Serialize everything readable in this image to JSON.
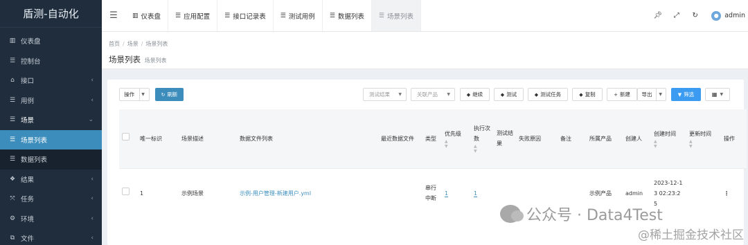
{
  "app": {
    "title": "盾测-自动化"
  },
  "sidebar": {
    "items": [
      {
        "icon": "bar-chart-icon",
        "label": "仪表盘"
      },
      {
        "icon": "list-icon",
        "label": "控制台"
      },
      {
        "icon": "bank-icon",
        "label": "接口"
      },
      {
        "icon": "list-icon",
        "label": "用例"
      },
      {
        "icon": "list-icon",
        "label": "场景"
      },
      {
        "icon": "list-icon",
        "label": "场景列表"
      },
      {
        "icon": "list-icon",
        "label": "数据列表"
      },
      {
        "icon": "cubes-icon",
        "label": "结果"
      },
      {
        "icon": "expand-icon",
        "label": "任务"
      },
      {
        "icon": "gear-icon",
        "label": "环境"
      },
      {
        "icon": "copy-icon",
        "label": "文件"
      }
    ]
  },
  "topbar": {
    "tabs": [
      {
        "icon": "bar-chart-icon",
        "label": "仪表盘"
      },
      {
        "icon": "list-icon",
        "label": "应用配置"
      },
      {
        "icon": "list-icon",
        "label": "接口记录表"
      },
      {
        "icon": "list-icon",
        "label": "测试用例"
      },
      {
        "icon": "list-icon",
        "label": "数据列表"
      },
      {
        "icon": "list-icon",
        "label": "场景列表"
      }
    ],
    "user": "admin"
  },
  "breadcrumb": [
    "首页",
    "场景",
    "场景列表"
  ],
  "page": {
    "title": "场景列表",
    "subtitle": "场景列表"
  },
  "toolbar": {
    "actions_label": "操作",
    "refresh_label": "刷新",
    "result_placeholder": "测试结果",
    "product_placeholder": "关联产品",
    "continue_label": "继续",
    "test_label": "测试",
    "test_task_label": "测试任务",
    "copy_label": "复制",
    "new_label": "新建",
    "export_label": "导出",
    "filter_label": "筛选"
  },
  "table": {
    "headers": {
      "id": "唯一标识",
      "desc": "场景描述",
      "files": "数据文件列表",
      "recent": "最近数据文件",
      "type": "类型",
      "priority": "优先级",
      "runs": "执行次数",
      "result": "测试结果",
      "fail": "失败原因",
      "remark": "备注",
      "product": "所属产品",
      "creator": "创建人",
      "created": "创建时间",
      "updated": "更新时间",
      "ops": "操作"
    },
    "rows": [
      {
        "id": "1",
        "desc": "示例场景",
        "files": "示例-用户管理-新建用户.yml",
        "recent": "",
        "type": "串行中断",
        "priority": "1",
        "runs": "1",
        "result": "",
        "fail": "",
        "remark": "",
        "product": "示例产品",
        "creator": "admin",
        "created": "2023-12-13 02:23:25",
        "updated": ""
      }
    ]
  },
  "watermarks": {
    "wechat": "公众号 · Data4Test",
    "site": "@稀土掘金技术社区"
  }
}
